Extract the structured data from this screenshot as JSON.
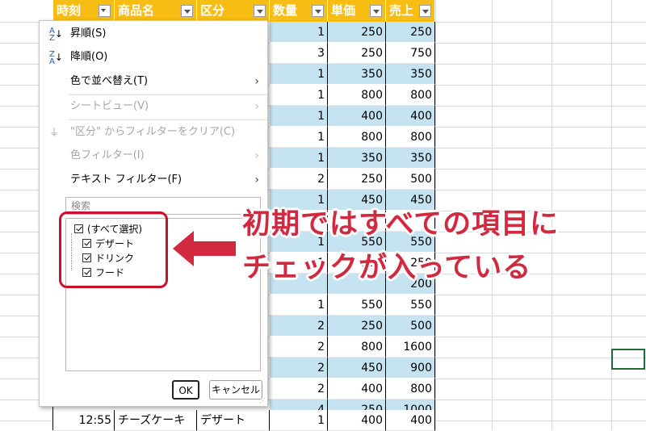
{
  "table": {
    "headers": [
      "時刻",
      "商品名",
      "区分",
      "数量",
      "単価",
      "売上"
    ],
    "rows": [
      {
        "qty": "1",
        "price": "250",
        "sales": "250"
      },
      {
        "qty": "3",
        "price": "250",
        "sales": "750"
      },
      {
        "qty": "1",
        "price": "350",
        "sales": "350"
      },
      {
        "qty": "1",
        "price": "800",
        "sales": "800"
      },
      {
        "qty": "1",
        "price": "400",
        "sales": "400"
      },
      {
        "qty": "1",
        "price": "800",
        "sales": "800"
      },
      {
        "qty": "1",
        "price": "350",
        "sales": "350"
      },
      {
        "qty": "2",
        "price": "250",
        "sales": "500"
      },
      {
        "qty": "1",
        "price": "450",
        "sales": "450"
      },
      {
        "qty": "",
        "price": "",
        "sales": ""
      },
      {
        "qty": "1",
        "price": "550",
        "sales": "550"
      },
      {
        "qty": "1",
        "price": "250",
        "sales": "250"
      },
      {
        "qty": "",
        "price": "",
        "sales": "200"
      },
      {
        "qty": "1",
        "price": "550",
        "sales": "550"
      },
      {
        "qty": "2",
        "price": "250",
        "sales": "500"
      },
      {
        "qty": "2",
        "price": "800",
        "sales": "1600"
      },
      {
        "qty": "2",
        "price": "450",
        "sales": "900"
      },
      {
        "qty": "2",
        "price": "400",
        "sales": "800"
      },
      {
        "qty": "4",
        "price": "250",
        "sales": "1000"
      }
    ],
    "last_row": {
      "time": "12:55",
      "product": "チーズケーキ",
      "category": "デザート",
      "qty": "1",
      "price": "400",
      "sales": "400"
    }
  },
  "menu": {
    "sort_asc": "昇順(S)",
    "sort_desc": "降順(O)",
    "sort_color": "色で並べ替え(T)",
    "sheet_view": "シートビュー(V)",
    "clear_filter": "\"区分\" からフィルターをクリア(C)",
    "color_filter": "色フィルター(I)",
    "text_filter": "テキスト フィルター(F)",
    "search_placeholder": "検索",
    "items": [
      "(すべて選択)",
      "デザート",
      "ドリンク",
      "フード"
    ],
    "ok": "OK",
    "cancel": "キャンセル"
  },
  "annotation": {
    "line1": "初期ではすべての項目に",
    "line2": "チェックが入っている",
    "color": "#d1293f"
  },
  "colors": {
    "header": "#f7bd14",
    "band": "#c6e3f1",
    "accent": "#c8102e"
  }
}
